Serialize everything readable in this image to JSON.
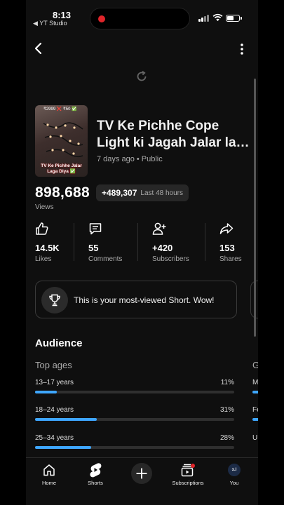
{
  "status_bar": {
    "time": "8:13",
    "back_app": "◀ YT Studio"
  },
  "video": {
    "title": "TV Ke Pichhe Cope Light ki Jagah Jalar la…",
    "meta": "7 days ago • Public",
    "thumbnail_prices": "₹2999 ❌ ₹50 ✅",
    "thumbnail_caption": "TV Ke Pichhe Jalar Laga Diya ✅"
  },
  "views": {
    "count": "898,688",
    "label": "Views",
    "delta": "+489,307",
    "period": "Last 48 hours"
  },
  "stats": [
    {
      "value": "14.5K",
      "label": "Likes",
      "icon": "thumbs-up-icon"
    },
    {
      "value": "55",
      "label": "Comments",
      "icon": "comment-icon"
    },
    {
      "value": "+420",
      "label": "Subscribers",
      "icon": "add-person-icon"
    },
    {
      "value": "153",
      "label": "Shares",
      "icon": "share-icon"
    }
  ],
  "banner": {
    "text": "This is your most-viewed Short. Wow!",
    "icon": "trophy-icon"
  },
  "audience": {
    "title": "Audience",
    "top_ages_label": "Top ages",
    "next_card_peek": "G",
    "ages": [
      {
        "range": "13–17 years",
        "percent": "11%",
        "value": 11
      },
      {
        "range": "18–24 years",
        "percent": "31%",
        "value": 31
      },
      {
        "range": "25–34 years",
        "percent": "28%",
        "value": 28
      }
    ],
    "next_card_rows": [
      "M",
      "Fe",
      "U"
    ]
  },
  "nav": {
    "items": [
      {
        "label": "Home",
        "icon": "home-icon"
      },
      {
        "label": "Shorts",
        "icon": "shorts-icon"
      },
      {
        "label": "",
        "icon": "create-icon"
      },
      {
        "label": "Subscriptions",
        "icon": "subscriptions-icon"
      },
      {
        "label": "You",
        "icon": "avatar"
      }
    ],
    "avatar_text": "ɔ.l"
  },
  "colors": {
    "accent": "#3ea6ff",
    "background": "#0f0f0f",
    "record": "#e0252a"
  }
}
